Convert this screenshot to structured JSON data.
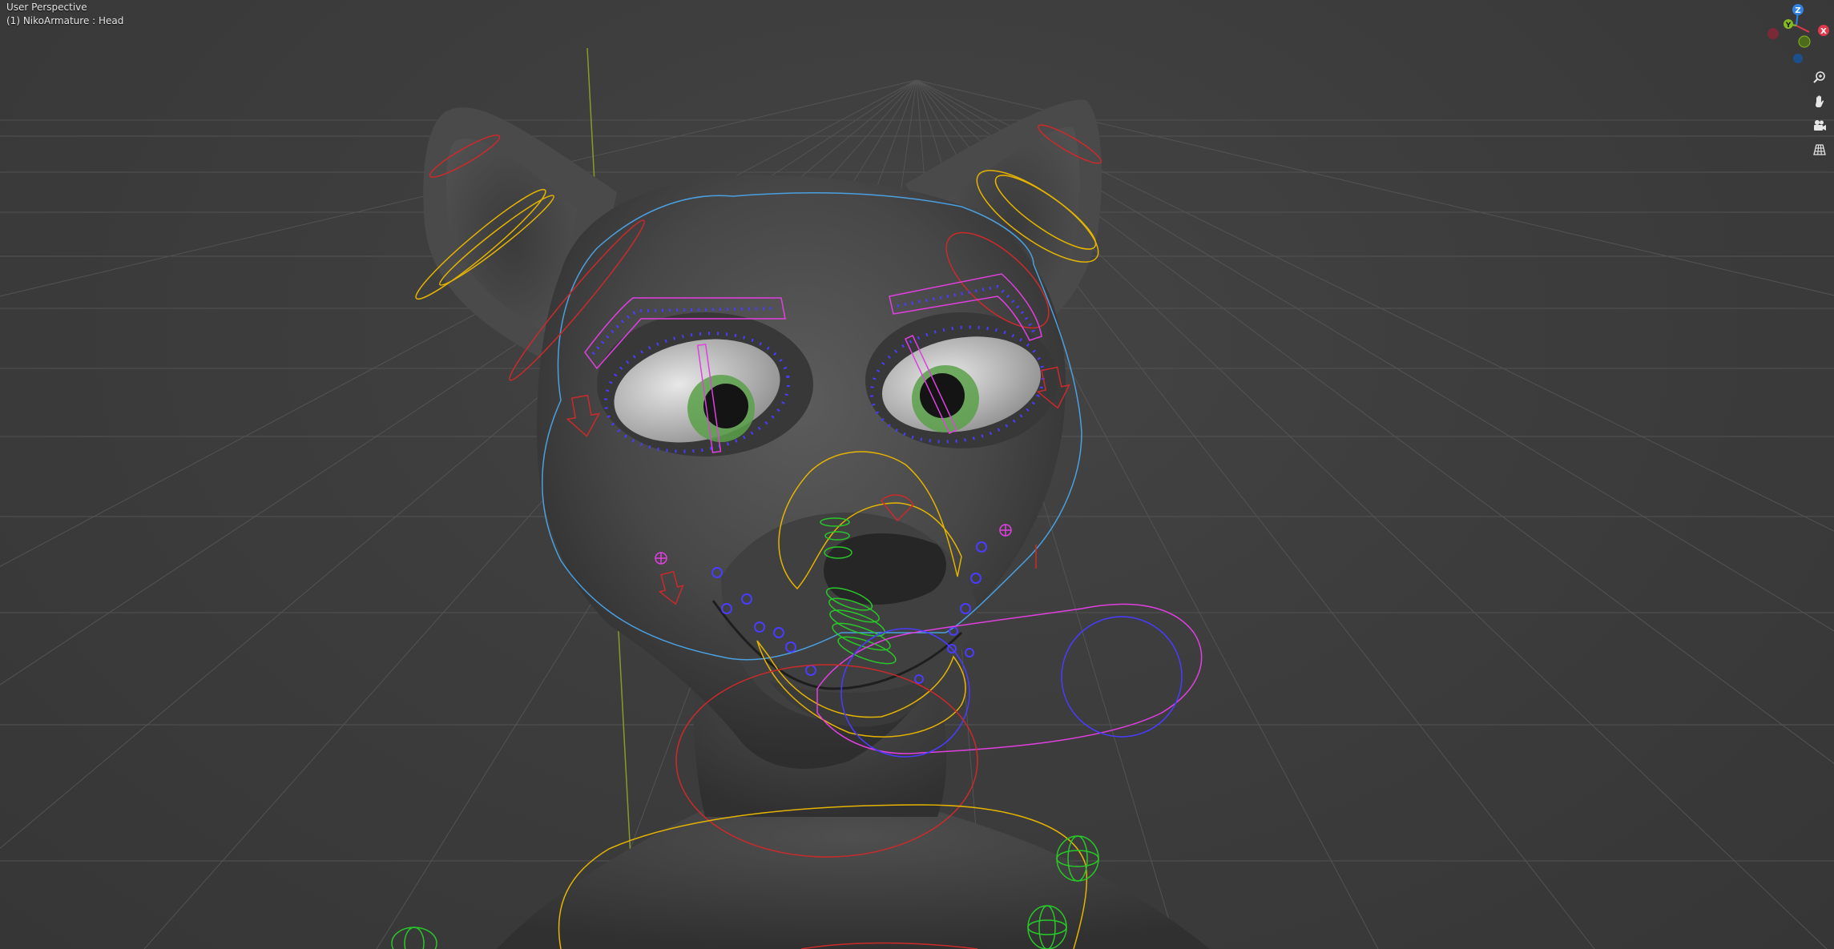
{
  "viewport": {
    "perspective_label": "User Perspective",
    "object_label": "(1) NikoArmature : Head"
  },
  "gizmo": {
    "axis_z": "Z",
    "axis_y": "Y",
    "axis_x": "X",
    "color_x": "#e0394c",
    "color_y": "#85bb1f",
    "color_z": "#2f83e6"
  },
  "nav_buttons": [
    {
      "icon": "zoom-icon"
    },
    {
      "icon": "hand-pan-icon"
    },
    {
      "icon": "camera-icon"
    },
    {
      "icon": "grid-perspective-icon"
    }
  ],
  "colors": {
    "background": "#3b3b3b",
    "grid": "#5a5a5a",
    "mesh": "#4c4c4c",
    "bone_red": "#cc2a2a",
    "bone_yellow": "#e5b400",
    "bone_pink": "#e040e0",
    "bone_blue": "#4a3cff",
    "bone_green": "#28c828",
    "bone_cyan": "#4aa0e0"
  }
}
